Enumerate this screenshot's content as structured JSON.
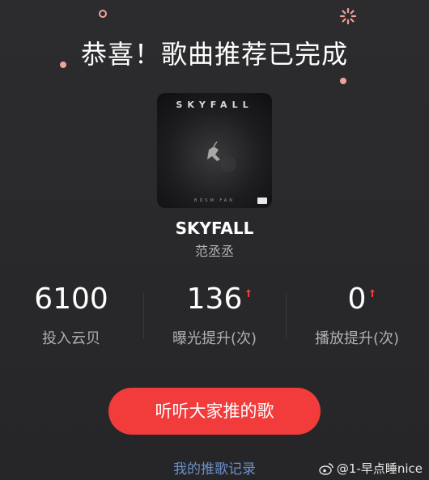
{
  "header": {
    "title": "恭喜！歌曲推荐已完成"
  },
  "album": {
    "cover_title": "SKYFALL",
    "cover_artist": "BDSM FAN"
  },
  "song": {
    "title": "SKYFALL",
    "artist": "范丞丞"
  },
  "stats": [
    {
      "value": "6100",
      "label": "投入云贝",
      "trend": "none"
    },
    {
      "value": "136",
      "label": "曝光提升(次)",
      "trend": "up"
    },
    {
      "value": "0",
      "label": "播放提升(次)",
      "trend": "up"
    }
  ],
  "actions": {
    "primary_label": "听听大家推的歌",
    "history_label": "我的推歌记录"
  },
  "watermark": {
    "text": "@1-早点睡nice"
  },
  "colors": {
    "background": "#2a2a2c",
    "accent": "#f23b3b",
    "link": "#6d8fc7",
    "confetti": "#f0a19c"
  }
}
